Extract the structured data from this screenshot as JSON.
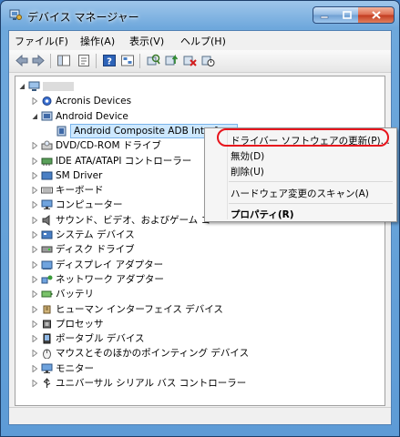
{
  "window": {
    "title": "デバイス マネージャー"
  },
  "menu": [
    {
      "label": "ファイル(F)"
    },
    {
      "label": "操作(A)"
    },
    {
      "label": "表示(V)"
    },
    {
      "label": "ヘルプ(H)"
    }
  ],
  "tree": {
    "root": "",
    "nodes": [
      {
        "label": "Acronis Devices"
      },
      {
        "label": "Android Device"
      },
      {
        "label": "Android Composite ADB Interface"
      },
      {
        "label": "DVD/CD-ROM ドライブ"
      },
      {
        "label": "IDE ATA/ATAPI コントローラー"
      },
      {
        "label": "SM Driver"
      },
      {
        "label": "キーボード"
      },
      {
        "label": "コンピューター"
      },
      {
        "label": "サウンド、ビデオ、およびゲーム コ"
      },
      {
        "label": "システム デバイス"
      },
      {
        "label": "ディスク ドライブ"
      },
      {
        "label": "ディスプレイ アダプター"
      },
      {
        "label": "ネットワーク アダプター"
      },
      {
        "label": "バッテリ"
      },
      {
        "label": "ヒューマン インターフェイス デバイス"
      },
      {
        "label": "プロセッサ"
      },
      {
        "label": "ポータブル デバイス"
      },
      {
        "label": "マウスとそのほかのポインティング デバイス"
      },
      {
        "label": "モニター"
      },
      {
        "label": "ユニバーサル シリアル バス コントローラー"
      }
    ]
  },
  "context_menu": {
    "items": [
      {
        "label": "ドライバー ソフトウェアの更新(P)..."
      },
      {
        "label": "無効(D)"
      },
      {
        "label": "削除(U)"
      },
      {
        "label": "ハードウェア変更のスキャン(A)"
      },
      {
        "label": "プロパティ(R)"
      }
    ]
  },
  "colors": {
    "highlight_ring": "#e8141c",
    "selection": "#cde8ff"
  }
}
